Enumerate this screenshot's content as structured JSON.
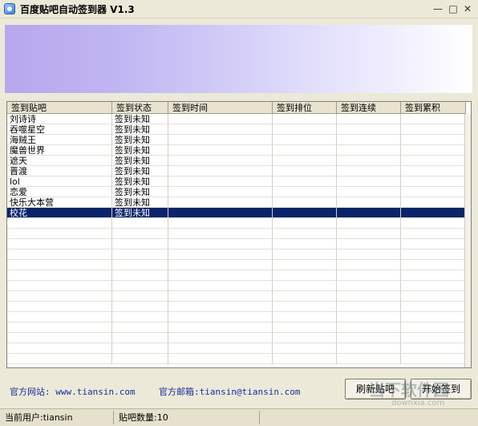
{
  "window": {
    "title": "百度贴吧自动签到器 V1.3",
    "icon": "app-icon",
    "controls": {
      "minimize": "—",
      "maximize": "□",
      "close": "✕"
    }
  },
  "table": {
    "columns": [
      "签到贴吧",
      "签到状态",
      "签到时间",
      "签到排位",
      "签到连续",
      "签到累积"
    ],
    "rows": [
      [
        "刘诗诗",
        "签到未知",
        "",
        "",
        "",
        ""
      ],
      [
        "吞噬星空",
        "签到未知",
        "",
        "",
        "",
        ""
      ],
      [
        "海贼王",
        "签到未知",
        "",
        "",
        "",
        ""
      ],
      [
        "魔兽世界",
        "签到未知",
        "",
        "",
        "",
        ""
      ],
      [
        "遮天",
        "签到未知",
        "",
        "",
        "",
        ""
      ],
      [
        "晋渡",
        "签到未知",
        "",
        "",
        "",
        ""
      ],
      [
        "lol",
        "签到未知",
        "",
        "",
        "",
        ""
      ],
      [
        "恋爱",
        "签到未知",
        "",
        "",
        "",
        ""
      ],
      [
        "快乐大本营",
        "签到未知",
        "",
        "",
        "",
        ""
      ],
      [
        "校花",
        "签到未知",
        "",
        "",
        "",
        ""
      ]
    ],
    "selected_index": 9,
    "empty_rows": 14
  },
  "footer": {
    "website": "官方网站: www.tiansin.com",
    "email": "官方邮箱:tiansin@tiansin.com",
    "refresh_button": "刷新贴吧",
    "start_button": "开始签到"
  },
  "status": {
    "user": "当前用户:tiansin",
    "count": "贴吧数量:10"
  },
  "watermark": {
    "text": "当下软件园",
    "url": "downxia.com"
  },
  "colors": {
    "selection": "#0a246a",
    "link": "#1a2fa0",
    "banner_start": "#b7a7ec"
  }
}
